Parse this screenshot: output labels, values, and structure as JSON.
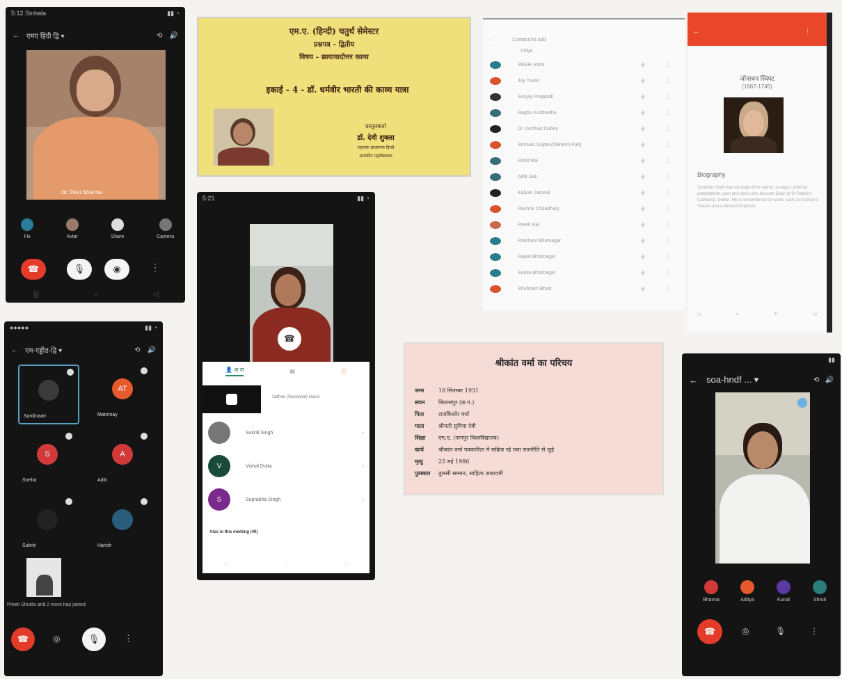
{
  "phone1": {
    "title": "एमए हिंदी द्वि ▾",
    "name_overlay": "Dr. Devi Sharma",
    "tray": [
      "Fix",
      "Avtar",
      "Share",
      "Camera"
    ],
    "buttons": [
      "end",
      "mute",
      "video"
    ]
  },
  "slide1": {
    "line1": "एम.ए. (हिन्दी) चतुर्थ सेमेस्टर",
    "line2": "प्रश्नपत्र – द्वितीय",
    "line3": "विषय – छायावादोत्तर काव्य",
    "line4": "इकाई - 4 - डॉ. धर्मवीर भारती की काव्य यात्रा",
    "presenter_label": "प्रस्तुतकर्ता",
    "presenter": "डॉ. देवी शुक्ला",
    "affil1": "सहायक प्राध्यापक हिन्दी",
    "affil2": "शासकीय महाविद्यालय"
  },
  "contacts": {
    "header_items": [
      "",
      "Contact list add"
    ],
    "names": [
      "Vidya",
      "SNEH Joshi",
      "Jay Tiwari",
      "Sanjay Prajapati",
      "Raghu Kushwaha",
      "Dr. Girdhari Dubey",
      "Srinivas Gupta (Mahesh Pati)",
      "Rohit Rai",
      "Aditi Jain",
      "Kalyan Jaiswal",
      "Rashmi Choudhary",
      "Preeti Rai",
      "Prashant Bhatnagar",
      "Rajani Bhatnagar",
      "Sunita Bhatnagar",
      "Shubham Bhatt"
    ],
    "colors": [
      "#2a7d8a",
      "#d9532c",
      "#333",
      "#3a6d7a",
      "#222",
      "#d9532c",
      "#3a6d7a",
      "#3a6d7a",
      "#222",
      "#d9532c",
      "#c96a4a",
      "#2a7d8a",
      "#2a7d8a",
      "#2a7d8a",
      "#d9532c"
    ]
  },
  "bio_panel": {
    "name": "जोनाथन स्विफ्ट",
    "years": "(1667-1745)",
    "heading": "Biography",
    "body": "Jonathan Swift was an Anglo-Irish satirist, essayist, political pamphleteer, poet and cleric who became Dean of St Patrick's Cathedral, Dublin. He is remembered for works such as Gulliver's Travels and A Modest Proposal."
  },
  "phone2": {
    "time": "5:21",
    "tabs": [
      "अ ज",
      "",
      ""
    ],
    "host_name": "Saffron (Sessional) Hours",
    "participants": [
      {
        "name": "Sukriti Singh",
        "initial": ""
      },
      {
        "name": "Vishal Dutta",
        "initial": "V"
      },
      {
        "name": "Suprabha Singh",
        "initial": "S"
      }
    ],
    "footer": "Also in this meeting (40)"
  },
  "phone3": {
    "title": "एम-एड्डीड-द्वि ▾",
    "tiles": [
      {
        "name": "Sardinaari",
        "initial": "",
        "color": "#3a3a3a"
      },
      {
        "name": "Matrimay",
        "initial": "AT",
        "color": "#e65a2e"
      },
      {
        "name": "Sneha",
        "initial": "S",
        "color": "#d23a3a"
      },
      {
        "name": "Aditi",
        "initial": "A",
        "color": "#d23a3a"
      },
      {
        "name": "Sukriti",
        "initial": "",
        "color": "#222"
      },
      {
        "name": "Harish",
        "initial": "",
        "color": "#2a5d7a"
      }
    ],
    "footer": "Preeti Shukla and 2 more has joined"
  },
  "slide2": {
    "title": "श्रीकांत वर्मा का परिचय",
    "rows": [
      {
        "k": "जन्म",
        "v": "18 सितम्बर 1931"
      },
      {
        "k": "स्थान",
        "v": "बिलासपुर (छ.ग.)"
      },
      {
        "k": "पिता",
        "v": "राजकिशोर वर्मा"
      },
      {
        "k": "माता",
        "v": "श्रीमती सुमित्रा देवी"
      },
      {
        "k": "शिक्षा",
        "v": "एम.ए. (नागपुर विश्वविद्यालय)"
      },
      {
        "k": "कार्य",
        "v": "श्रीकांत वर्मा पत्रकारिता में सक्रिय रहे तथा राजनीति से जुड़े"
      },
      {
        "k": "मृत्यु",
        "v": "25 मई 1986"
      },
      {
        "k": "पुरस्कार",
        "v": "तुलसी सम्मान, साहित्य अकादमी"
      }
    ]
  },
  "phone4": {
    "title": "soa-hndf ... ▾",
    "tray": [
      {
        "name": "Bhavna",
        "color": "#d23a3a"
      },
      {
        "name": "Aditya",
        "color": "#e65a2e"
      },
      {
        "name": "Kunal",
        "color": "#5a3aa0"
      },
      {
        "name": "Shruti",
        "color": "#2a7d7a"
      }
    ]
  }
}
